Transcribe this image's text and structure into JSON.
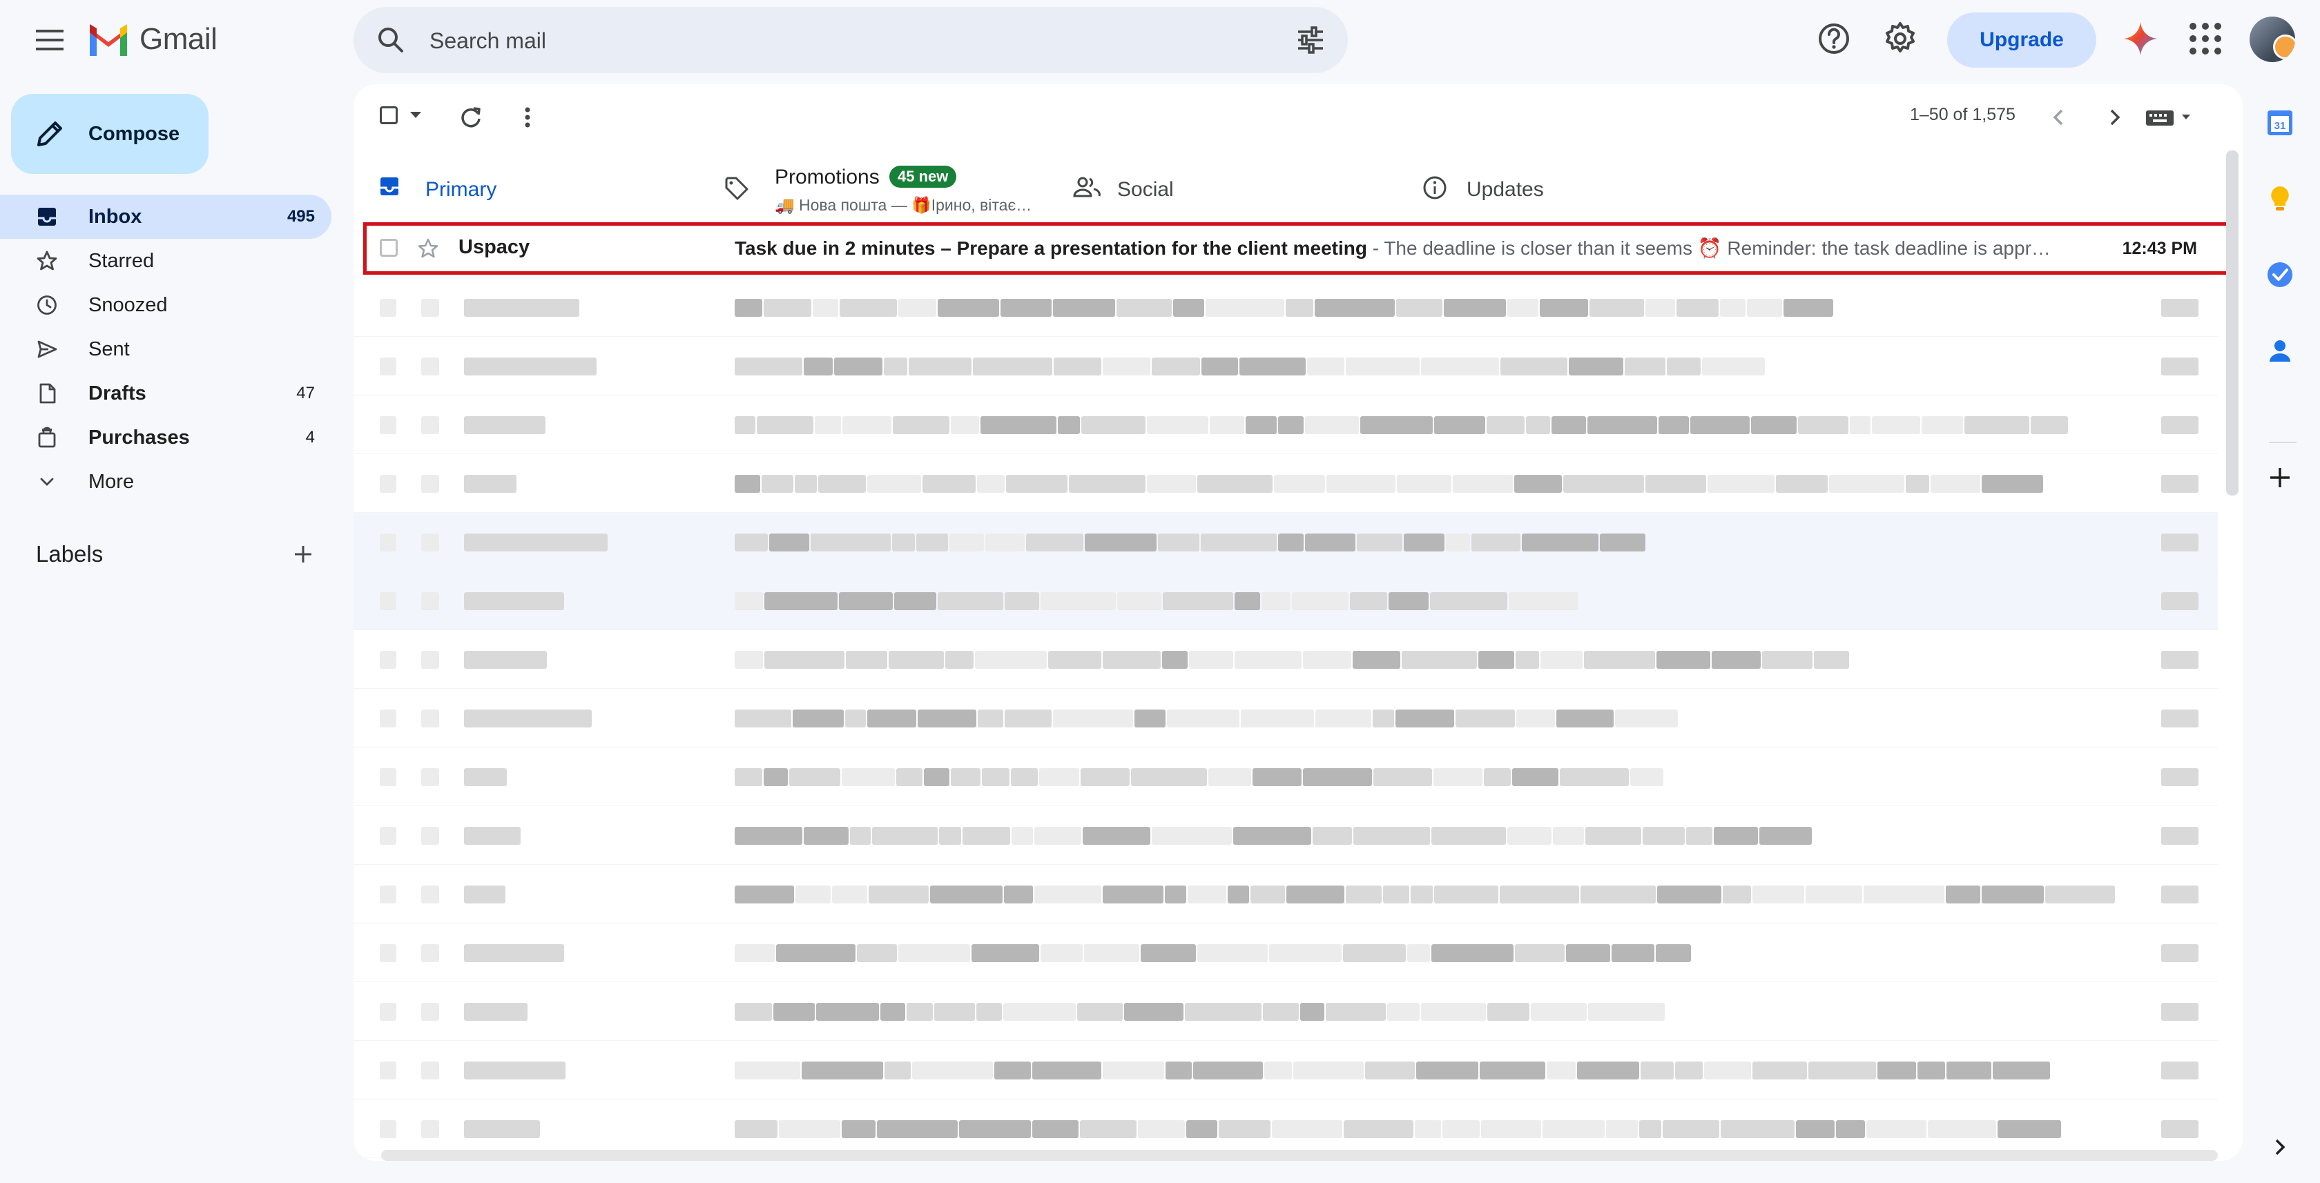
{
  "app": {
    "name": "Gmail"
  },
  "search": {
    "placeholder": "Search mail"
  },
  "header": {
    "upgrade_label": "Upgrade"
  },
  "compose": {
    "label": "Compose"
  },
  "sidebar": {
    "items": [
      {
        "label": "Inbox",
        "count": "495"
      },
      {
        "label": "Starred",
        "count": ""
      },
      {
        "label": "Snoozed",
        "count": ""
      },
      {
        "label": "Sent",
        "count": ""
      },
      {
        "label": "Drafts",
        "count": "47"
      },
      {
        "label": "Purchases",
        "count": "4"
      },
      {
        "label": "More",
        "count": ""
      }
    ],
    "labels_heading": "Labels"
  },
  "toolbar": {
    "pager_text": "1–50 of 1,575"
  },
  "tabs": {
    "primary": "Primary",
    "promotions": "Promotions",
    "promotions_badge": "45 new",
    "promotions_snippet": "🚚 Нова пошта — 🎁Ірино, вітає…",
    "social": "Social",
    "updates": "Updates"
  },
  "emails": [
    {
      "sender": "Uspacy",
      "subject": "Task due in 2 minutes – Prepare a presentation for the client meeting",
      "snippet": " - The deadline is closer than it seems ⏰ Reminder: the task deadline is appr…",
      "time": "12:43 PM"
    }
  ],
  "icons": {
    "menu": "menu-icon",
    "search": "search-icon",
    "tune": "tune-icon",
    "help": "help-icon",
    "settings": "gear-icon",
    "gemini": "gemini-icon",
    "apps": "apps-grid-icon",
    "compose": "pencil-icon",
    "inbox": "inbox-icon",
    "star": "star-icon",
    "snooze": "clock-icon",
    "sent": "send-icon",
    "drafts": "draft-icon",
    "purchases": "shopping-bag-icon",
    "more": "chevron-down-icon",
    "calendar": "calendar-icon",
    "keep": "keep-icon",
    "tasks": "tasks-icon",
    "contacts": "contacts-icon"
  },
  "colors": {
    "accent": "#0b57d0",
    "compose_bg": "#c2e7ff",
    "active_nav": "#d3e3fd",
    "badge": "#188038",
    "highlight": "#d0121b"
  }
}
